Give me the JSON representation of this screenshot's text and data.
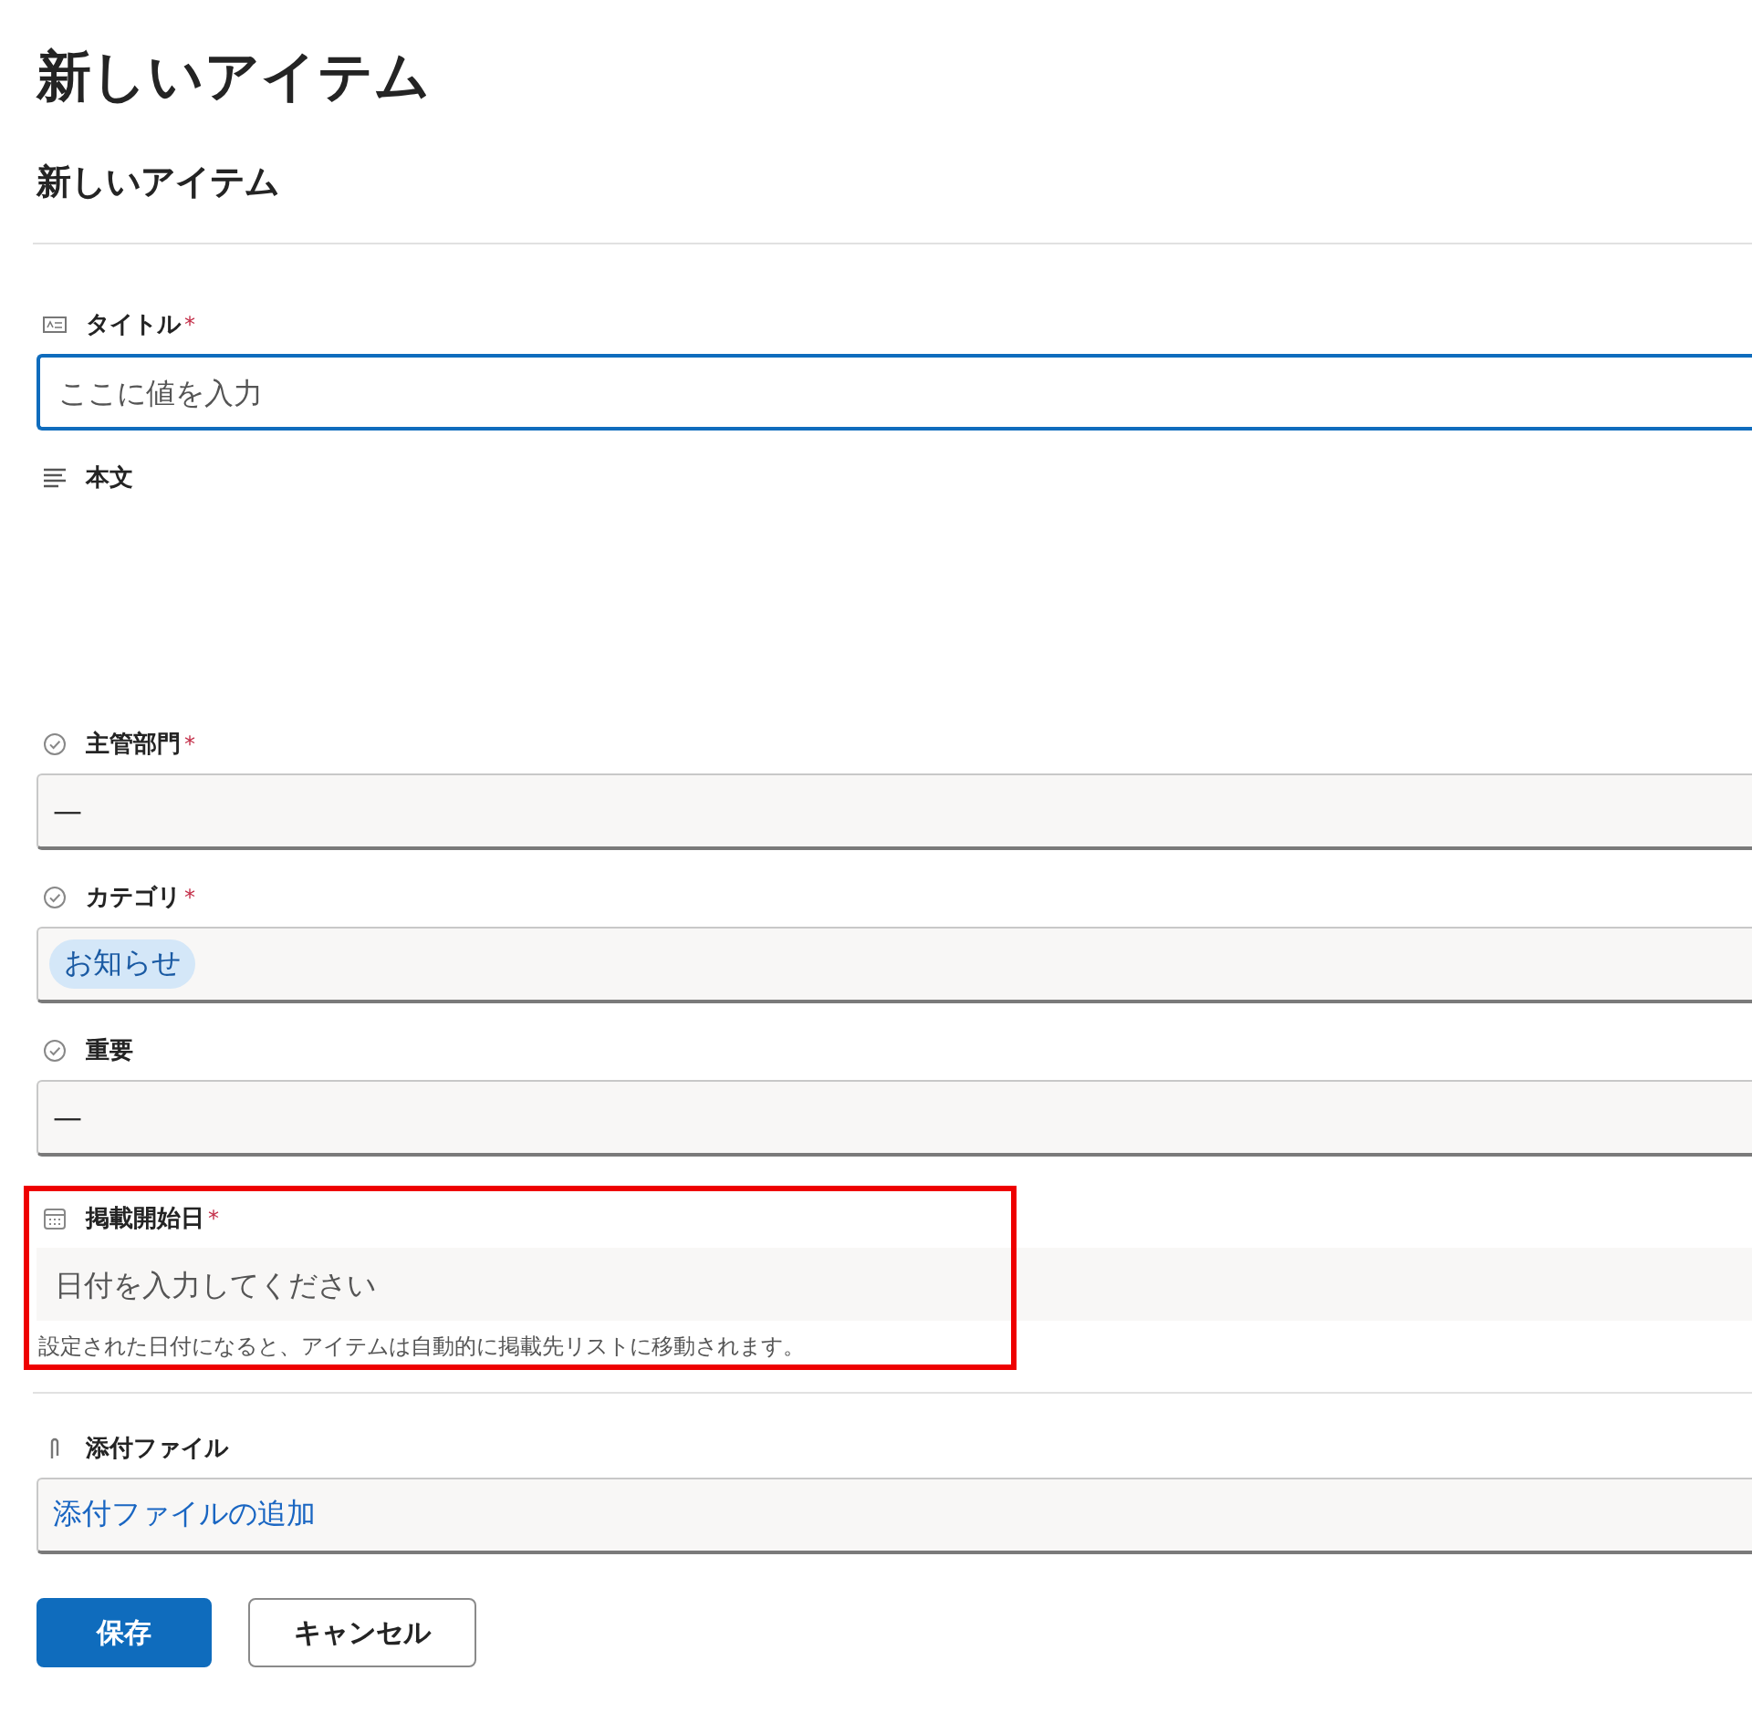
{
  "page_title": "新しいアイテム",
  "form_title": "新しいアイテム",
  "fields": [
    {
      "kind": "text",
      "label": "タイトル",
      "required_mark": "*",
      "placeholder": "ここに値を入力",
      "focused": true
    },
    {
      "kind": "richtext",
      "label": "本文"
    },
    {
      "kind": "choice",
      "label": "主管部門",
      "required_mark": "*",
      "value": "—"
    },
    {
      "kind": "choice",
      "label": "カテゴリ",
      "required_mark": "*",
      "tags": [
        "お知らせ"
      ]
    },
    {
      "kind": "choice",
      "label": "重要",
      "value": "—"
    },
    {
      "kind": "date",
      "label": "掲載開始日",
      "required_mark": "*",
      "placeholder": "日付を入力してください",
      "hint": "設定された日付になると、アイテムは自動的に掲載先リストに移動されます。",
      "highlighted": true
    },
    {
      "kind": "attachment",
      "label": "添付ファイル",
      "link": "添付ファイルの追加"
    }
  ],
  "buttons": [
    {
      "label": "保存",
      "primary": true
    },
    {
      "label": "キャンセル",
      "primary": false
    }
  ]
}
